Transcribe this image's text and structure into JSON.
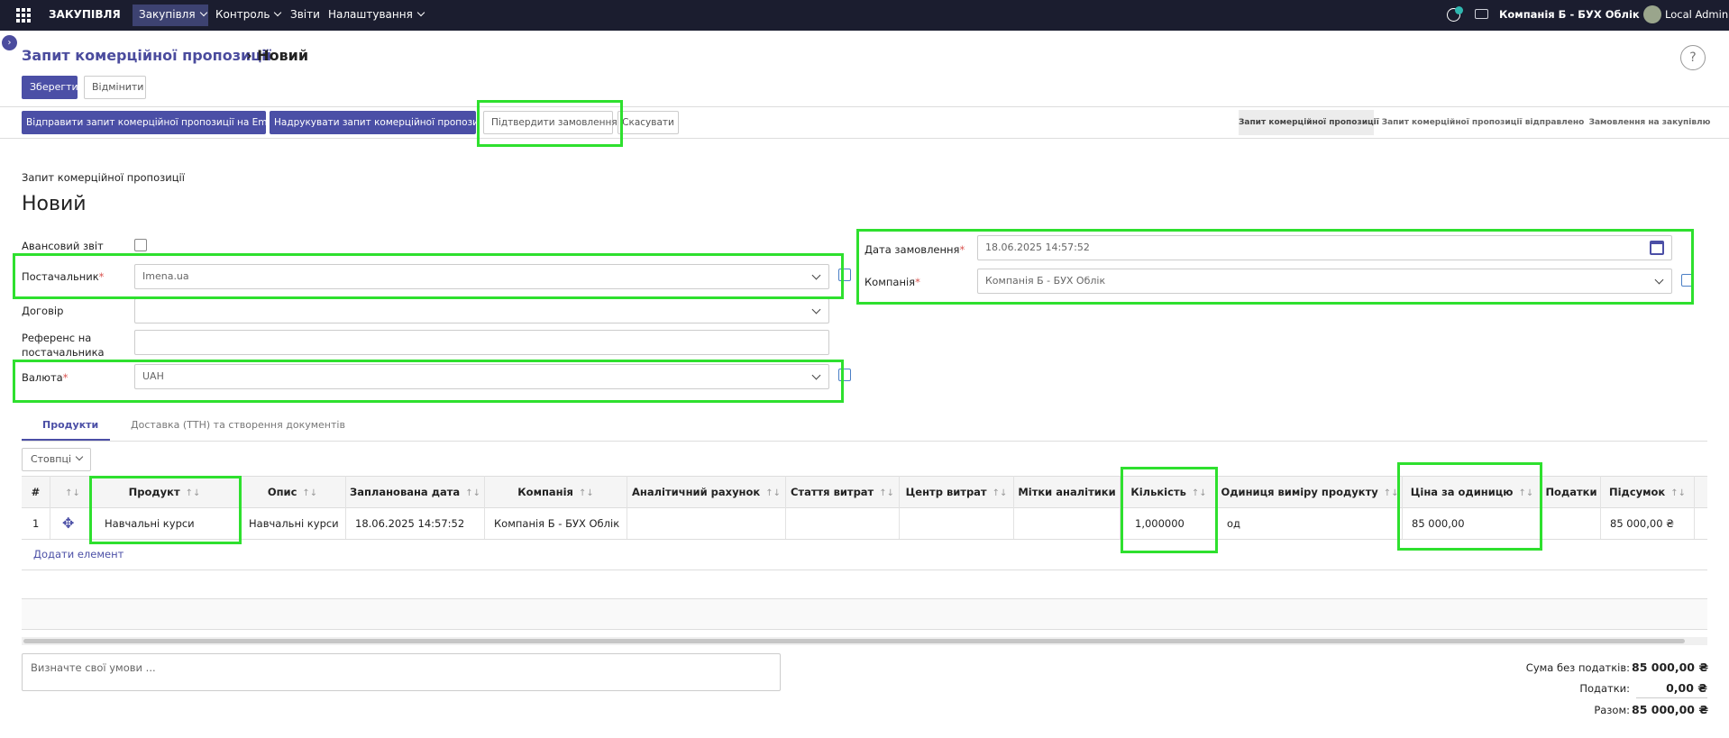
{
  "navbar": {
    "app_name": "ЗАКУПІВЛЯ",
    "menu": [
      "Закупівля",
      "Контроль",
      "Звіти",
      "Налаштування"
    ],
    "company_switcher": "Компанія Б - БУХ Облік",
    "user": "Local Admin"
  },
  "header": {
    "breadcrumb_parent": "Запит комерційної пропозиції",
    "breadcrumb_current": "Новий",
    "save_label": "Зберегти",
    "discard_label": "Відмінити",
    "help_label": "?"
  },
  "actions": {
    "send_email": "Відправити запит комерційної пропозиції на Email",
    "print": "Надрукувати запит комерційної пропозиції",
    "confirm": "Підтвердити замовлення",
    "cancel": "Скасувати"
  },
  "statusbar": [
    "Запит комерційної пропозиції",
    "Запит комерційної пропозиції відправлено",
    "Замовлення на закупівлю"
  ],
  "form": {
    "doc_type": "Запит комерційної пропозиції",
    "title": "Новий",
    "advance_report_label": "Авансовий звіт",
    "supplier_label": "Постачальник",
    "supplier_value": "Imena.ua",
    "contract_label": "Договір",
    "contract_value": "",
    "supplier_ref_label_1": "Референс на",
    "supplier_ref_label_2": "постачальника",
    "supplier_ref_value": "",
    "currency_label": "Валюта",
    "currency_value": "UAH",
    "order_date_label": "Дата замовлення",
    "order_date_value": "18.06.2025 14:57:52",
    "company_label": "Компанія",
    "company_value": "Компанія Б - БУХ Облік",
    "required_mark": "*"
  },
  "tabs": [
    "Продукти",
    "Доставка (ТТН) та створення документів"
  ],
  "columns_button": "Стовпці",
  "table": {
    "headers": [
      "#",
      "Продукт",
      "Опис",
      "Запланована дата",
      "Компанія",
      "Аналітичний рахунок",
      "Стаття витрат",
      "Центр витрат",
      "Мітки аналітики",
      "Кількість",
      "Одиниця виміру продукту",
      "Ціна за одиницю",
      "Податки",
      "Підсумок"
    ],
    "sort_glyph": "↑↓",
    "rows": [
      {
        "num": "1",
        "product": "Навчальні курси",
        "description": "Навчальні курси",
        "planned_date": "18.06.2025 14:57:52",
        "company": "Компанія Б - БУХ Облік",
        "analytic_account": "",
        "expense_item": "",
        "cost_center": "",
        "analytic_tags": "",
        "quantity": "1,000000",
        "uom": "од",
        "unit_price": "85 000,00",
        "taxes": "",
        "subtotal": "85 000,00 ₴"
      }
    ],
    "add_item": "Додати елемент"
  },
  "terms_placeholder": "Визначте свої умови ...",
  "totals": {
    "untaxed_label": "Сума без податків:",
    "untaxed_value": "85 000,00 ₴",
    "taxes_label": "Податки:",
    "taxes_value": "0,00 ₴",
    "total_label": "Разом:",
    "total_value": "85 000,00 ₴"
  },
  "colors": {
    "navbar": "#1b1d2f",
    "primary": "#4b4fa6",
    "highlight": "#2ee02e"
  }
}
